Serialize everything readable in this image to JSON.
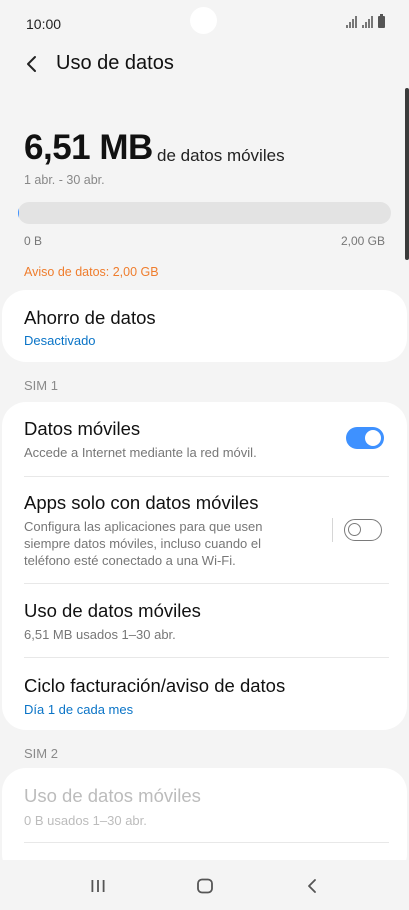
{
  "status_bar": {
    "time": "10:00"
  },
  "header": {
    "title": "Uso de datos"
  },
  "usage": {
    "amount": "6,51 MB",
    "unit": "de datos móviles",
    "period": "1 abr. - 30 abr.",
    "bar_min": "0 B",
    "bar_max": "2,00 GB",
    "fill_fraction": 0.003,
    "warning": "Aviso de datos: 2,00 GB"
  },
  "data_saver": {
    "title": "Ahorro de datos",
    "status": "Desactivado"
  },
  "sim1": {
    "label": "SIM 1",
    "mobile_data": {
      "title": "Datos móviles",
      "subtitle": "Accede a Internet mediante la red móvil.",
      "enabled": true
    },
    "mobile_only_apps": {
      "title": "Apps solo con datos móviles",
      "subtitle_lines": [
        "Configura las aplicaciones para que usen",
        "siempre datos móviles, incluso cuando el",
        "teléfono esté conectado a una Wi-Fi."
      ],
      "enabled": false
    },
    "mobile_data_usage": {
      "title": "Uso de datos móviles",
      "subtitle": "6,51 MB usados 1–30 abr."
    },
    "billing_cycle": {
      "title": "Ciclo facturación/aviso de datos",
      "subtitle": "Día 1 de cada mes"
    }
  },
  "sim2": {
    "label": "SIM 2",
    "mobile_data_usage": {
      "title": "Uso de datos móviles",
      "subtitle": "0 B usados 1–30 abr."
    }
  },
  "colors": {
    "accent": "#3e91ff",
    "link": "#0a74c7",
    "warning": "#ef7d2d",
    "background": "#f4f4f4"
  },
  "icons": {
    "back": "back-arrow-icon",
    "recent_apps": "recent-apps-icon",
    "home": "home-icon",
    "nav_back": "nav-back-icon"
  }
}
